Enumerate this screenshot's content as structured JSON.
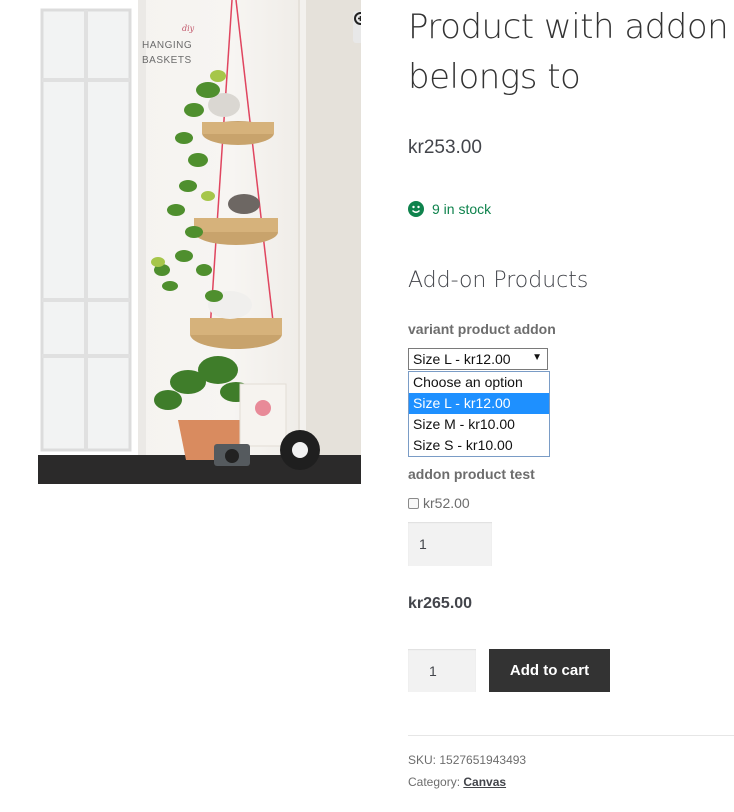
{
  "product": {
    "title": "Product with addon belongs to",
    "price": "kr253.00",
    "stock_text": "9 in stock",
    "image": {
      "caption_small": "diy",
      "caption_line1": "HANGING",
      "caption_line2": "BASKETS"
    }
  },
  "addons": {
    "heading": "Add-on Products",
    "variant": {
      "label": "variant product addon",
      "selected": "Size L - kr12.00",
      "options": [
        "Choose an option",
        "Size L - kr12.00",
        "Size M - kr10.00",
        "Size S - kr10.00"
      ],
      "selected_index": 1
    },
    "test": {
      "label": "addon product test",
      "checkbox_label": "kr52.00",
      "checked": false,
      "quantity": "1"
    }
  },
  "total": "kr265.00",
  "cart": {
    "quantity": "1",
    "button_label": "Add to cart"
  },
  "meta": {
    "sku_label": "SKU: ",
    "sku_value": "1527651943493",
    "category_label": "Category: ",
    "category_value": "Canvas"
  },
  "colors": {
    "in_stock": "#0f834d",
    "button_bg": "#333333",
    "option_highlight": "#1e90ff"
  },
  "icons": {
    "zoom": "zoom-in-icon",
    "stock": "smiley-icon",
    "select": "caret-down-icon"
  }
}
